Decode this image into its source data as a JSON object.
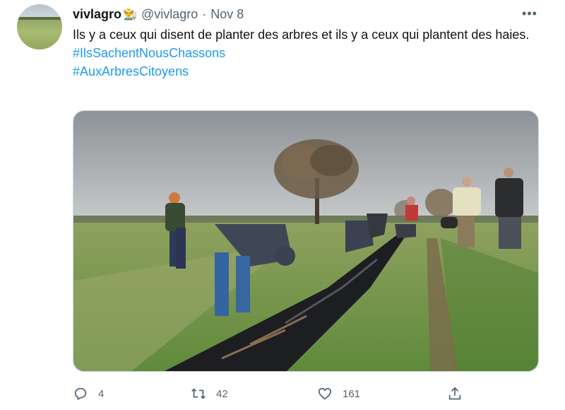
{
  "tweet": {
    "author_name": "vivlagro",
    "author_emoji": "👨‍🌾",
    "handle": "@vivlagro",
    "separator": "·",
    "date": "Nov 8",
    "more_label": "•••",
    "text": "Ils y a ceux qui disent de planter des arbres et ils y a ceux qui plantent des haies.",
    "hashtags": [
      "#IlsSachentNousChassons",
      "#AuxArbresCitoyens"
    ]
  },
  "actions": {
    "reply_count": "4",
    "retweet_count": "42",
    "like_count": "161"
  },
  "colors": {
    "link": "#1d9bf0",
    "secondary_text": "#536471"
  },
  "icons": {
    "reply": "reply-icon",
    "retweet": "retweet-icon",
    "like": "heart-icon",
    "share": "share-icon",
    "more": "more-icon"
  }
}
